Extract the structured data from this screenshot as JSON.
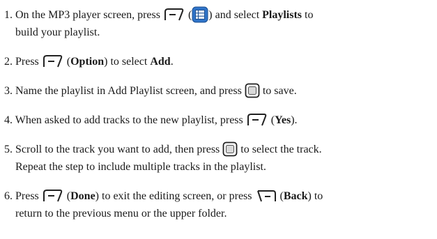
{
  "steps": [
    {
      "num": "1.",
      "l1_a": "On the MP3 player screen, press",
      "l1_b": "(",
      "l1_c": ") and select",
      "l1_bold": "Playlists",
      "l1_d": "to",
      "l2": "build your playlist."
    },
    {
      "num": "2.",
      "a": "Press",
      "b": "(",
      "bold1": "Option",
      "c": ") to select",
      "bold2": "Add",
      "d": "."
    },
    {
      "num": "3.",
      "a": "Name the playlist in Add Playlist screen, and press",
      "b": "to save."
    },
    {
      "num": "4.",
      "a": "When asked to add tracks to the new playlist, press",
      "b": "(",
      "bold": "Yes",
      "c": ")."
    },
    {
      "num": "5.",
      "a": "Scroll to the track you want to add, then press",
      "b": "to select the track.",
      "l2": "Repeat the step to include multiple tracks in the playlist."
    },
    {
      "num": "6.",
      "a": "Press",
      "b": "(",
      "bold1": "Done",
      "c": ") to exit the editing screen, or press",
      "d": "(",
      "bold2": "Back",
      "e": ") to",
      "l2": "return to the previous menu or the upper folder."
    }
  ],
  "icons": {
    "soft_key": "left-soft-key-icon",
    "menu": "menu-list-icon",
    "center": "center-select-key-icon",
    "back": "back-key-icon"
  },
  "colors": {
    "text": "#1a1a1a",
    "key_stroke": "#222222",
    "menu_blue": "#2f74c9"
  }
}
